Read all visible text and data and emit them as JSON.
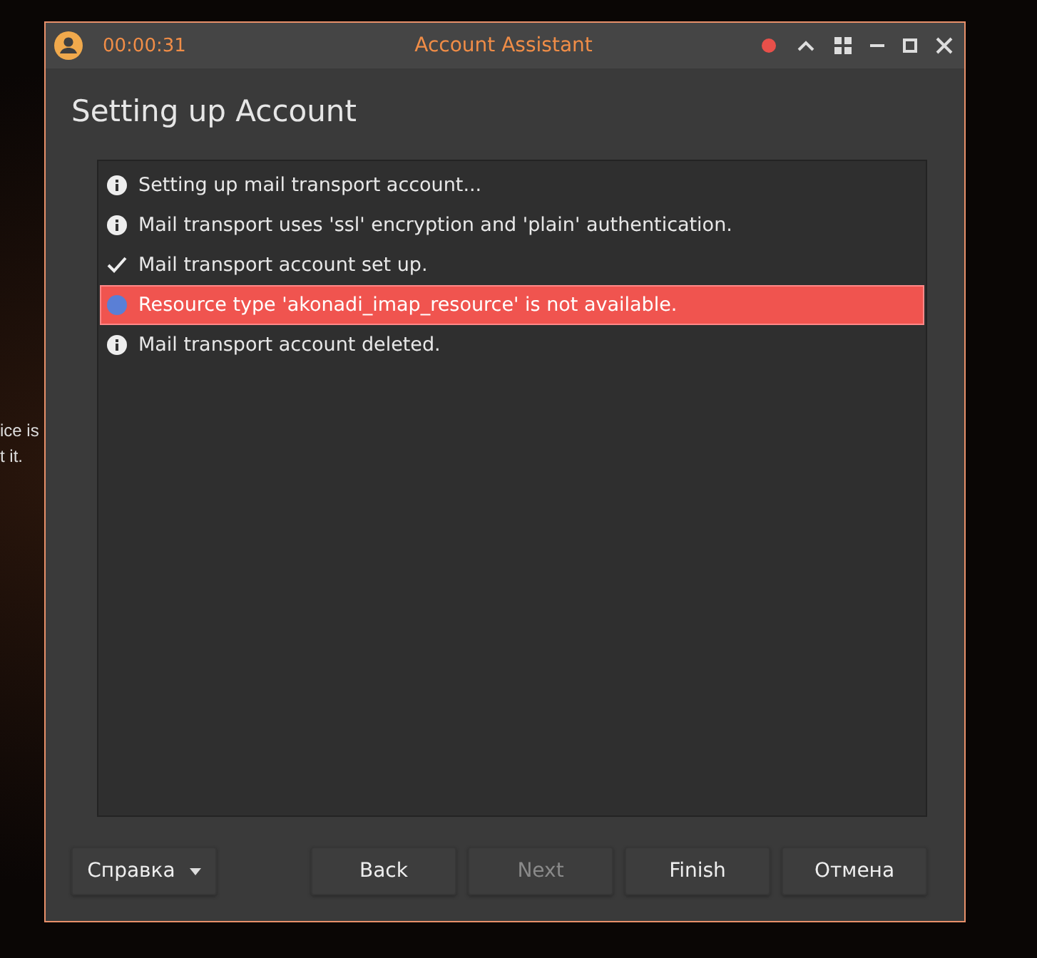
{
  "background_text": [
    "ice is",
    "t it."
  ],
  "window": {
    "timer": "00:00:31",
    "title": "Account Assistant"
  },
  "heading": "Setting up Account",
  "log": [
    {
      "kind": "info",
      "text": "Setting up mail transport account..."
    },
    {
      "kind": "info",
      "text": "Mail transport uses 'ssl' encryption and 'plain' authentication."
    },
    {
      "kind": "success",
      "text": "Mail transport account set up."
    },
    {
      "kind": "error",
      "text": "Resource type 'akonadi_imap_resource' is not available."
    },
    {
      "kind": "info",
      "text": "Mail transport account deleted."
    }
  ],
  "help_button": "Справка",
  "buttons": [
    {
      "label": "Back",
      "disabled": false
    },
    {
      "label": "Next",
      "disabled": true
    },
    {
      "label": "Finish",
      "disabled": false
    },
    {
      "label": "Отмена",
      "disabled": false
    }
  ]
}
